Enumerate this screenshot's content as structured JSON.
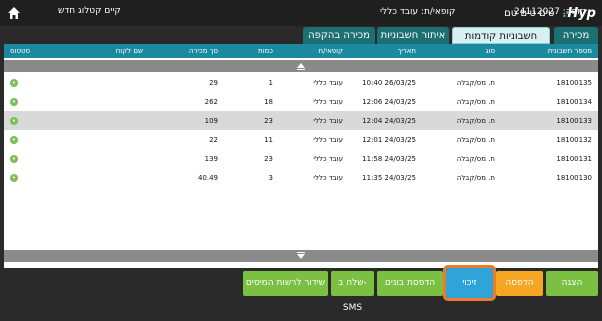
{
  "topbar": {
    "logo_text": "Hyp",
    "terminal_label": "טים טים טם",
    "store_info": "קופה: 24112027",
    "cashier_info": "קופאי/ת: עובד כללי",
    "catalog_button": "קיים קטלוג חדש",
    "home_icon": "home-icon"
  },
  "tabs": [
    {
      "label": "מכירה"
    },
    {
      "label": "חשבוניות קודמות"
    },
    {
      "label": "איתור חשבוניות"
    },
    {
      "label": "מכירה בהקפה"
    }
  ],
  "table": {
    "columns": [
      "מספר חשבונית",
      "סוג",
      "תאריך",
      "קופאי/ת",
      "כמות",
      "סך מכירה",
      "שם לקוח",
      "סטטוס"
    ],
    "rows": [
      {
        "invoice": "18100135",
        "type": "ח. מס/קבלה",
        "date": "10:40 26/03/25",
        "cashier": "עובד כללי",
        "qty": "1",
        "total": "29",
        "customer": "",
        "status": "ok"
      },
      {
        "invoice": "18100134",
        "type": "ח. מס/קבלה",
        "date": "12:06 24/03/25",
        "cashier": "עובד כללי",
        "qty": "18",
        "total": "262",
        "customer": "",
        "status": "ok"
      },
      {
        "invoice": "18100133",
        "type": "ח. מס/קבלה",
        "date": "12:04 24/03/25",
        "cashier": "עובד כללי",
        "qty": "23",
        "total": "109",
        "customer": "",
        "status": "ok"
      },
      {
        "invoice": "18100132",
        "type": "ח. מס/קבלה",
        "date": "12:01 24/03/25",
        "cashier": "עובד כללי",
        "qty": "11",
        "total": "22",
        "customer": "",
        "status": "ok"
      },
      {
        "invoice": "18100131",
        "type": "ח. מס/קבלה",
        "date": "11:58 24/03/25",
        "cashier": "עובד כללי",
        "qty": "23",
        "total": "139",
        "customer": "",
        "status": "ok"
      },
      {
        "invoice": "18100130",
        "type": "ח. מס/קבלה",
        "date": "11:35 24/03/25",
        "cashier": "עובד כללי",
        "qty": "3",
        "total": "40.49",
        "customer": "",
        "status": "ok"
      }
    ]
  },
  "buttons": {
    "display": "הצגה",
    "print": "הדפסה",
    "credit": "זיכוי",
    "print_vouchers": "הדפסת בונים",
    "send_sms": "שלח ב-SMS",
    "send_tax": "שידור לרשות המיסים"
  },
  "colors": {
    "tab_active": "#1c6f73",
    "header": "#1b8aa0",
    "green": "#7bc043",
    "orange": "#f5a623",
    "blue": "#2fa4d9",
    "highlight": "#f07a2a"
  }
}
